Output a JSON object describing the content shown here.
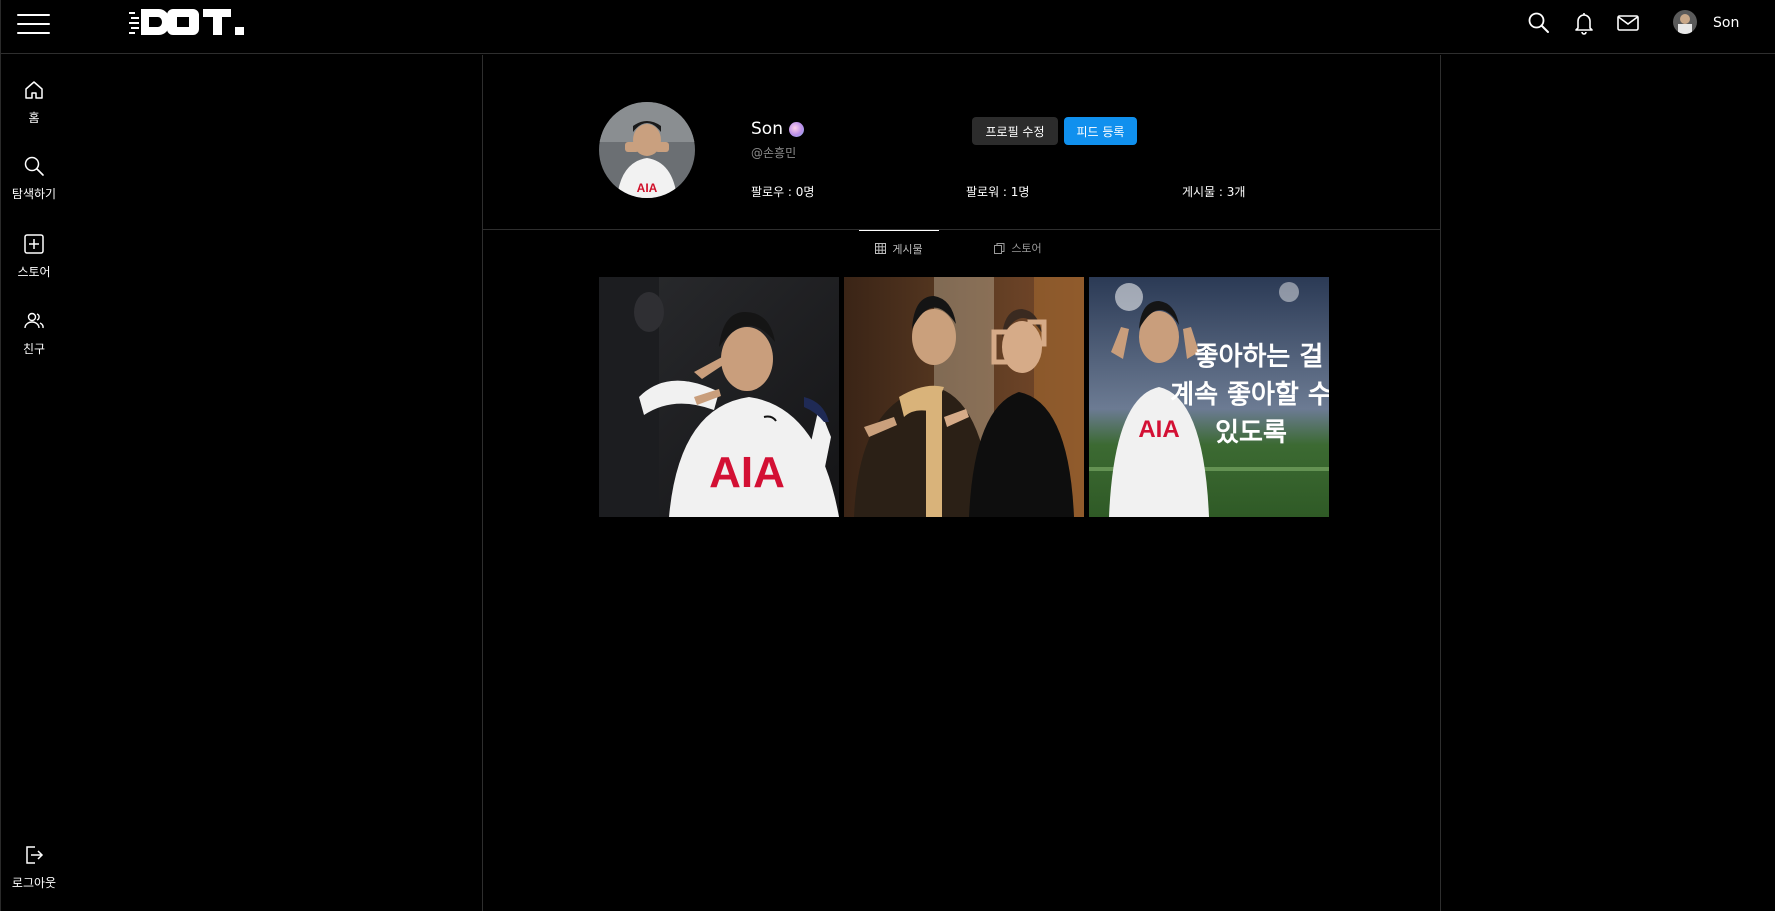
{
  "app": {
    "logo_text": "DOT."
  },
  "header": {
    "icons": [
      "menu-icon",
      "search-icon",
      "bell-icon",
      "mail-icon"
    ],
    "username": "Son"
  },
  "sidebar": {
    "items": [
      {
        "label": "홈",
        "icon": "home-icon"
      },
      {
        "label": "탐색하기",
        "icon": "search-icon"
      },
      {
        "label": "스토어",
        "icon": "plus-square-icon"
      },
      {
        "label": "친구",
        "icon": "friends-icon"
      }
    ],
    "logout": {
      "label": "로그아웃",
      "icon": "logout-icon"
    }
  },
  "profile": {
    "name": "Son",
    "handle": "@손흥민",
    "edit_button": "프로필 수정",
    "feed_button": "피드 등록",
    "stats": {
      "following": "팔로우 : 0명",
      "followers": "팔로워 : 1명",
      "posts": "게시물 : 3개"
    }
  },
  "tabs": [
    {
      "label": "게시물",
      "icon": "grid-icon",
      "active": true
    },
    {
      "label": "스토어",
      "icon": "copy-icon",
      "active": false
    }
  ],
  "posts": [
    {
      "caption": ""
    },
    {
      "caption": ""
    },
    {
      "caption_lines": [
        "좋아하는 걸",
        "계속 좋아할 수",
        "있도록"
      ]
    }
  ],
  "colors": {
    "accent": "#1090ee",
    "background": "#000000",
    "divider": "#2e2e2e"
  }
}
